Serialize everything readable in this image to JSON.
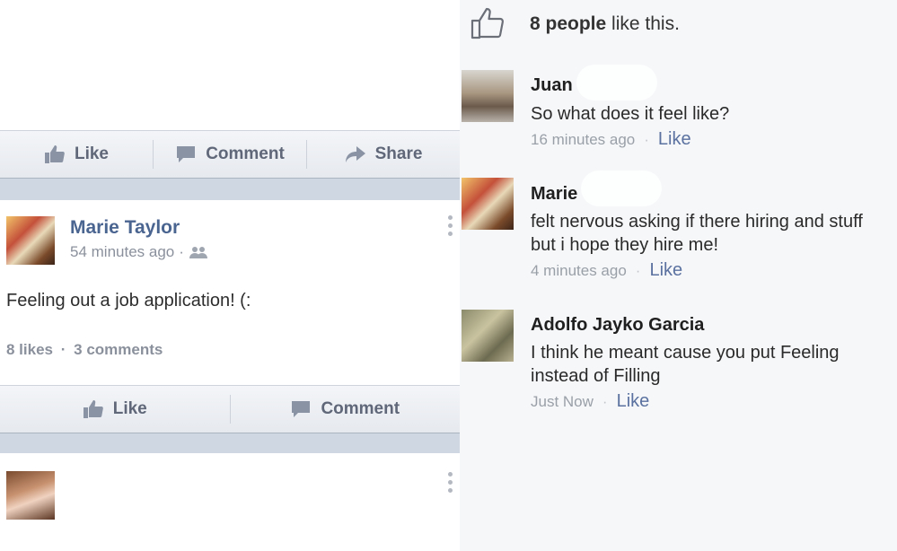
{
  "top_action_bar": {
    "like": "Like",
    "comment": "Comment",
    "share": "Share"
  },
  "post": {
    "author": "Marie Taylor",
    "time": "54 minutes ago",
    "text": "Feeling out a job application! (:",
    "likes": "8 likes",
    "comments": "3 comments"
  },
  "post_action_bar": {
    "like": "Like",
    "comment": "Comment"
  },
  "likes_summary": {
    "count": "8 people",
    "suffix": "like this."
  },
  "comments": [
    {
      "name": "Juan",
      "text": "So what does it feel like?",
      "time": "16 minutes ago",
      "like": "Like"
    },
    {
      "name": "Marie",
      "text": "felt nervous asking if there hiring and stuff but i hope they hire me!",
      "time": "4 minutes ago",
      "like": "Like"
    },
    {
      "name": "Adolfo Jayko Garcia",
      "text": "I think he meant cause you put Feeling instead of Filling",
      "time": "Just Now",
      "like": "Like"
    }
  ],
  "separator": "·",
  "icons": [
    "thumbs-up-icon",
    "comment-icon",
    "share-icon",
    "friends-icon",
    "more-vert-icon"
  ],
  "colors": {
    "name_blue": "#4b6591",
    "like_blue": "#5b72a0",
    "band": "#cfd7e2"
  }
}
